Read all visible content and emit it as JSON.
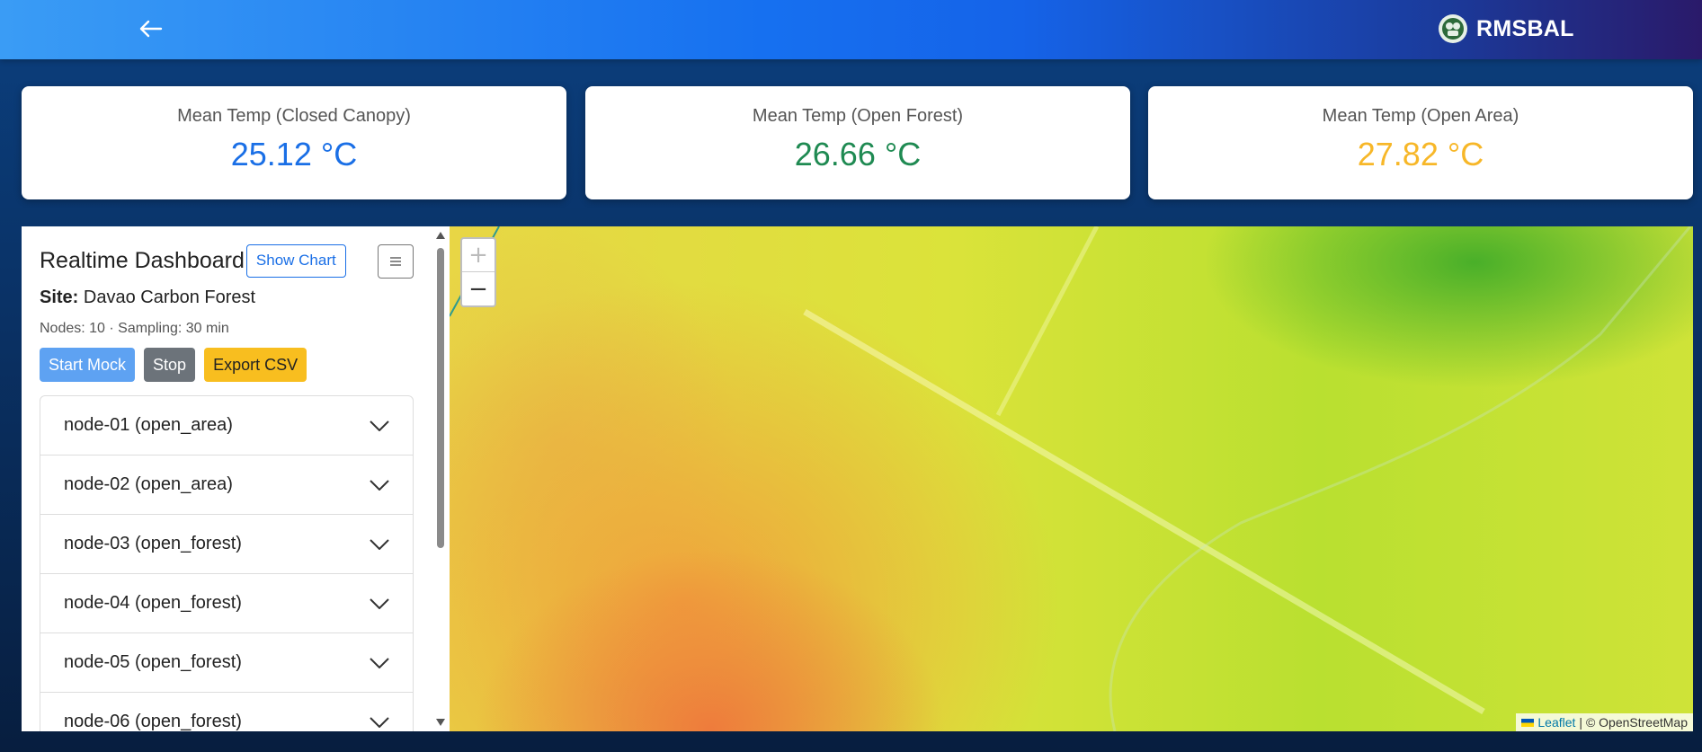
{
  "header": {
    "brand_name": "RMSBAL",
    "icons": {
      "back": "arrow-left-icon",
      "logo": "rmsbal-logo-icon"
    }
  },
  "stats": [
    {
      "label": "Mean Temp (Closed Canopy)",
      "value": "25.12 °C",
      "color": "#1a6fe6"
    },
    {
      "label": "Mean Temp (Open Forest)",
      "value": "26.66 °C",
      "color": "#1f8a52"
    },
    {
      "label": "Mean Temp (Open Area)",
      "value": "27.82 °C",
      "color": "#f7b728"
    }
  ],
  "panel": {
    "title": "Realtime Dashboard",
    "show_chart_label": "Show Chart",
    "menu_icon": "hamburger-icon",
    "site_label": "Site:",
    "site_name": "Davao Carbon Forest",
    "meta": "Nodes: 10 · Sampling: 30 min",
    "buttons": {
      "start": "Start Mock",
      "stop": "Stop",
      "export": "Export CSV"
    },
    "nodes": [
      "node-01 (open_area)",
      "node-02 (open_area)",
      "node-03 (open_forest)",
      "node-04 (open_forest)",
      "node-05 (open_forest)",
      "node-06 (open_forest)"
    ]
  },
  "map": {
    "zoom_in": "+",
    "zoom_out": "−",
    "attribution_link": "Leaflet",
    "attribution_text": "| © OpenStreetMap"
  },
  "colors": {
    "accent": "#1a6fe6",
    "stop": "#6c737a",
    "export": "#f8be1f",
    "start": "#5ea2f2"
  }
}
